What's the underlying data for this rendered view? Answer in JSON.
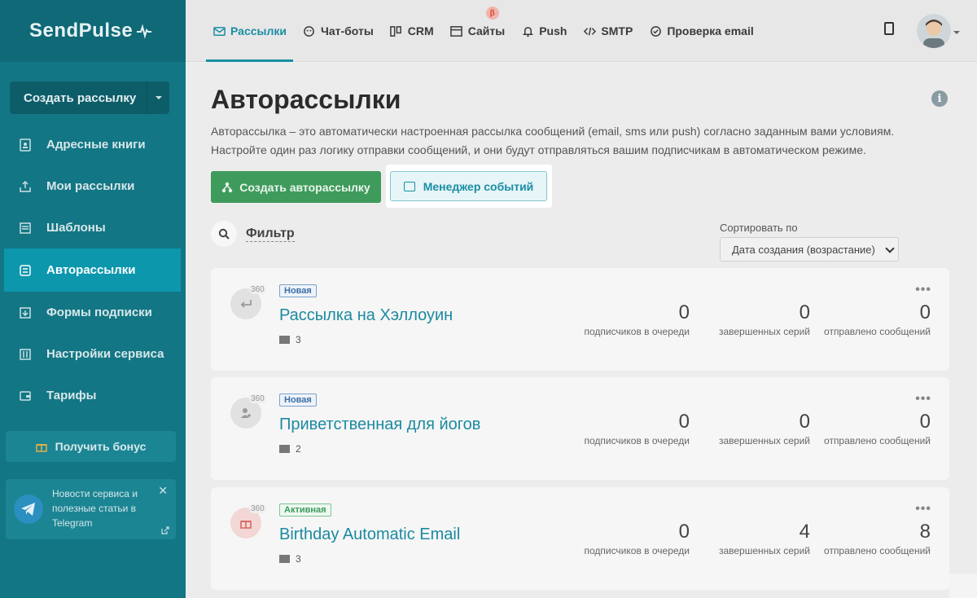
{
  "app": {
    "logo": "SendPulse"
  },
  "sidebar": {
    "create_button": "Создать рассылку",
    "items": [
      {
        "label": "Адресные книги",
        "icon": "address-book-icon"
      },
      {
        "label": "Мои рассылки",
        "icon": "mailings-icon"
      },
      {
        "label": "Шаблоны",
        "icon": "templates-icon"
      },
      {
        "label": "Авторассылки",
        "icon": "automation-icon",
        "active": true
      },
      {
        "label": "Формы подписки",
        "icon": "forms-icon"
      },
      {
        "label": "Настройки сервиса",
        "icon": "settings-icon"
      },
      {
        "label": "Тарифы",
        "icon": "wallet-icon"
      }
    ],
    "bonus": "Получить бонус",
    "telegram_text": "Новости сервиса и полезные статьи в Telegram"
  },
  "topnav": {
    "tabs": [
      {
        "label": "Рассылки",
        "icon": "mail-icon",
        "active": true
      },
      {
        "label": "Чат-боты",
        "icon": "chatbot-icon"
      },
      {
        "label": "CRM",
        "icon": "crm-icon"
      },
      {
        "label": "Сайты",
        "icon": "sites-icon",
        "badge": "β"
      },
      {
        "label": "Push",
        "icon": "bell-icon"
      },
      {
        "label": "SMTP",
        "icon": "code-icon"
      },
      {
        "label": "Проверка email",
        "icon": "check-circle-icon"
      }
    ]
  },
  "page": {
    "title": "Авторассылки",
    "description": "Авторассылка – это автоматически настроенная рассылка сообщений (email, sms или push) согласно заданным вами условиям. Настройте один раз логику отправки сообщений, и они будут отправляться вашим подписчикам в автоматическом режиме.",
    "create_button": "Создать авторассылку",
    "events_button": "Менеджер событий",
    "filter_label": "Фильтр",
    "sort_label": "Сортировать по",
    "sort_value": "Дата создания (возрастание)"
  },
  "stat_labels": {
    "queue": "подписчиков в очереди",
    "series": "завершенных серий",
    "sent": "отправлено сообщений"
  },
  "campaigns": [
    {
      "badge": "360",
      "status": "Новая",
      "status_type": "new",
      "name": "Рассылка на Хэллоуин",
      "letters": "3",
      "queue": "0",
      "series": "0",
      "sent": "0"
    },
    {
      "badge": "360",
      "status": "Новая",
      "status_type": "new",
      "name": "Приветственная для йогов",
      "letters": "2",
      "queue": "0",
      "series": "0",
      "sent": "0"
    },
    {
      "badge": "360",
      "status": "Активная",
      "status_type": "active",
      "name": "Birthday Automatic Email",
      "letters": "3",
      "queue": "0",
      "series": "4",
      "sent": "8"
    }
  ],
  "colors": {
    "sidebar": "#137684",
    "active_nav": "#0c97ad",
    "accent": "#1a8ea3",
    "green": "#3f9b5c"
  }
}
